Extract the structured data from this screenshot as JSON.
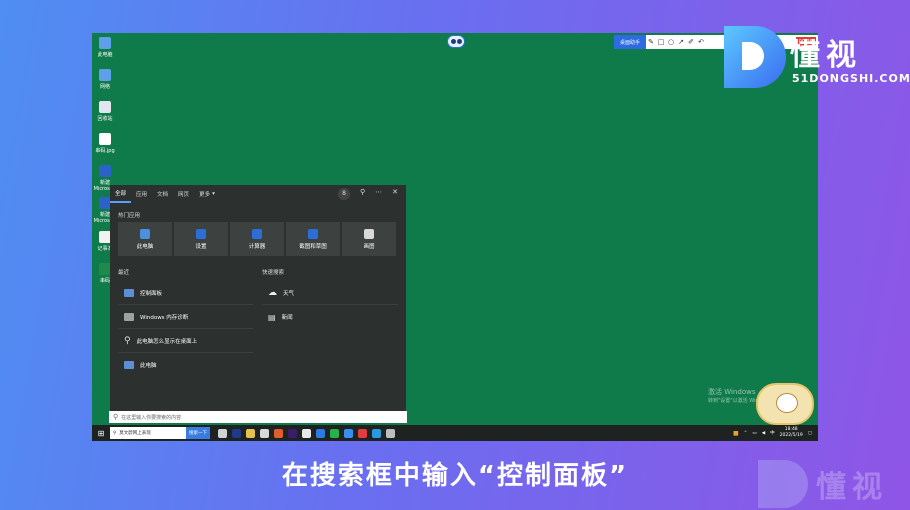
{
  "desktop": {
    "icons": [
      {
        "label": "此电脑",
        "icon": "computer-icon",
        "color": "#5ea0e8"
      },
      {
        "label": "网络",
        "icon": "network-icon",
        "color": "#5ea0e8"
      },
      {
        "label": "回收站",
        "icon": "recycle-bin-icon",
        "color": "#dfe7ee"
      },
      {
        "label": "串码.jpg",
        "icon": "image-file-icon",
        "color": "#ffffff"
      },
      {
        "label": "新建 Microsoft",
        "icon": "word-doc-icon",
        "color": "#2b62c8"
      },
      {
        "label": "新建 Microsoft",
        "icon": "word-doc-icon",
        "color": "#2b62c8"
      },
      {
        "label": "记事本",
        "icon": "notepad-icon",
        "color": "#f2f2f2"
      },
      {
        "label": "串码",
        "icon": "excel-icon",
        "color": "#1f8a4c"
      }
    ],
    "toolbar": {
      "label": "桌面助手",
      "record": "00:36"
    },
    "activate_line1": "激活 Windows",
    "activate_line2": "转到\"设置\"以激活 Windows"
  },
  "start_menu": {
    "tabs": [
      "全部",
      "应用",
      "文档",
      "网页",
      "更多"
    ],
    "more_caret": "▾",
    "badge": "8",
    "top_apps_title": "热门应用",
    "top_apps": [
      {
        "label": "此电脑",
        "icon": "computer-icon",
        "color": "#4a8fe0"
      },
      {
        "label": "设置",
        "icon": "gear-icon",
        "color": "#2b6fd6"
      },
      {
        "label": "计算器",
        "icon": "calculator-icon",
        "color": "#2b6fd6"
      },
      {
        "label": "截图和草图",
        "icon": "snip-icon",
        "color": "#2b6fd6"
      },
      {
        "label": "画图",
        "icon": "paint-icon",
        "color": "#d8d8d8"
      }
    ],
    "recent_title": "最近",
    "recent": [
      {
        "label": "控制面板",
        "icon": "control-panel-icon"
      },
      {
        "label": "Windows 内存诊断",
        "icon": "memory-diagnostic-icon"
      },
      {
        "label": "此电脑怎么显示在桌面上",
        "icon": "search-icon"
      },
      {
        "label": "此电脑",
        "icon": "computer-icon"
      }
    ],
    "quick_title": "快速搜索",
    "quick": [
      {
        "label": "天气",
        "icon": "weather-icon"
      },
      {
        "label": "新闻",
        "icon": "news-icon"
      }
    ],
    "search_placeholder": "在这里输入你要搜索的内容"
  },
  "taskbar": {
    "search_text": "莫文蔚网上表现",
    "search_button": "搜索一下",
    "time": "18:48",
    "date": "2022/5/19",
    "input_method": "中"
  },
  "brand": {
    "name": "懂视",
    "url": "51DONGSHI.COM"
  },
  "caption": "在搜索框中输入“控制面板”"
}
